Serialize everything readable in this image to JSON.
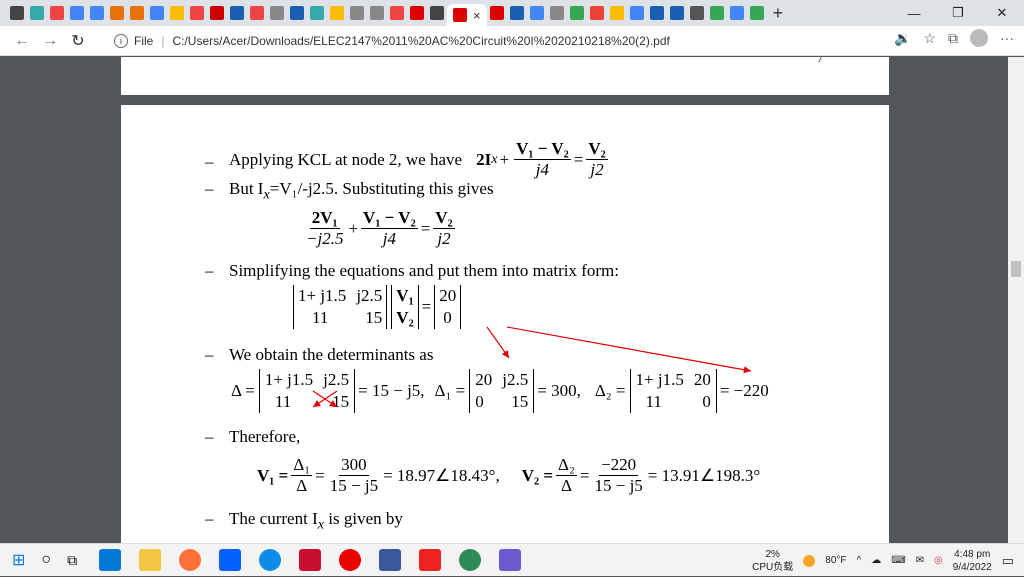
{
  "browser": {
    "tab_close": "×",
    "new_tab": "+",
    "minimize": "—",
    "restore": "❐",
    "close": "✕",
    "back": "←",
    "forward": "→",
    "reload": "↻",
    "info": "i",
    "file_label": "File",
    "url": "C:/Users/Acer/Downloads/ELEC2147%2011%20AC%20Circuit%20I%2020210218%20(2).pdf",
    "menu": "···"
  },
  "doc": {
    "prev_page_number": "7",
    "bullet": "–",
    "l1_text": "Applying KCL at node 2, we have",
    "l1_eq_left": "2I",
    "l1_sub": "x",
    "plus": "+",
    "eq": "=",
    "f1_num": "V₁ − V₂",
    "f1_den": "j4",
    "f2_num": "V₂",
    "f2_den": "j2",
    "l2_text": "But I",
    "l2_sub": "x",
    "l2_rest": "=V₁/-j2.5.  Substituting this gives",
    "f3_num": "2V₁",
    "f3_den": "−j2.5",
    "l3_text": "Simplifying the equations and put them into matrix form:",
    "m11": "1+ j1.5",
    "m12": "j2.5",
    "m21": "11",
    "m22": "15",
    "v1": "V₁",
    "v2": "V₂",
    "r1": "20",
    "r2": "0",
    "l4_text": "We obtain the determinants as",
    "delta": "Δ =",
    "delta_result": "= 15 − j5,",
    "delta1": "Δ₁ =",
    "d1_11": "20",
    "d1_12": "j2.5",
    "d1_21": "0",
    "d1_22": "15",
    "delta1_result": "= 300,",
    "delta2": "Δ₂ =",
    "d2_11": "1+ j1.5",
    "d2_12": "20",
    "d2_21": "11",
    "d2_22": "0",
    "delta2_result": "= −220",
    "l5_text": "Therefore,",
    "v1_eq": "V₁ =",
    "fd1_num": "Δ₁",
    "fd1_den": "Δ",
    "fv1_num": "300",
    "fv1_den": "15 − j5",
    "v1_result": "= 18.97∠18.43°,",
    "v2_eq": "V₂ =",
    "fd2_num": "Δ₂",
    "fd2_den": "Δ",
    "fv2_num": "−220",
    "fv2_den": "15 − j5",
    "v2_result": "= 13.91∠198.3°",
    "l6_text": "The current I",
    "l6_sub": "x",
    "l6_rest": " is given by"
  },
  "taskbar": {
    "cpu_percent": "2%",
    "cpu_label": "CPU负载",
    "temperature": "80°F",
    "time": "4:48 pm",
    "date": "9/4/2022"
  },
  "colors": {
    "annotation_red": "#e00000"
  }
}
